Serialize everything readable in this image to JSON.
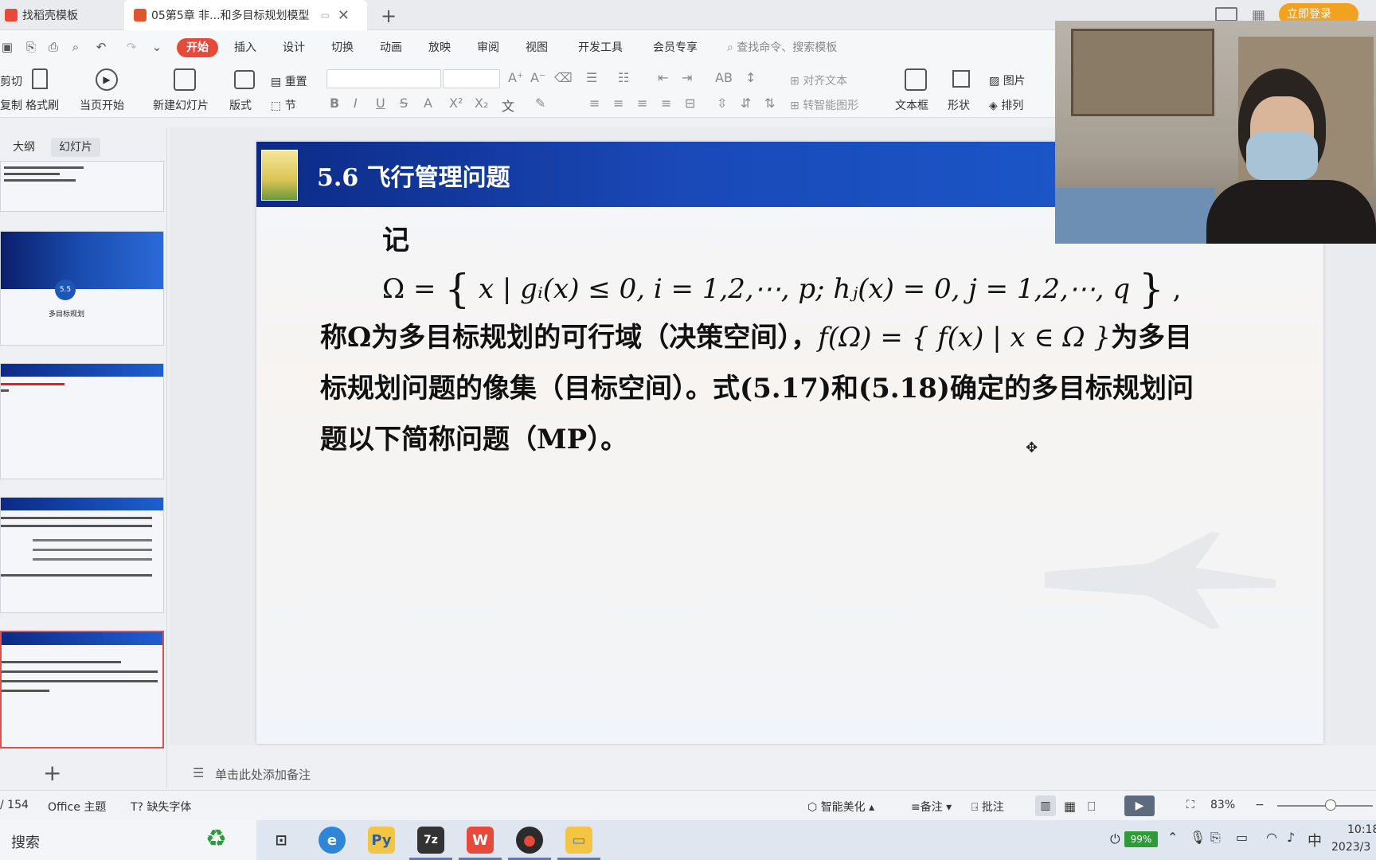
{
  "tabs": [
    {
      "label": "找稻壳模板"
    },
    {
      "label": "05第5章  非...和多目标规划模型"
    }
  ],
  "login_label": "立即登录",
  "menu": {
    "items": [
      "开始",
      "插入",
      "设计",
      "切换",
      "动画",
      "放映",
      "审阅",
      "视图",
      "开发工具",
      "会员专享"
    ],
    "search_placeholder": "查找命令、搜索模板"
  },
  "ribbon": {
    "cut": "剪切",
    "copy": "复制",
    "format_painter": "格式刷",
    "play_from_current": "当页开始",
    "new_slide": "新建幻灯片",
    "layout": "版式",
    "reset": "重置",
    "section": "节",
    "align_text": "对齐文本",
    "smart_shape": "转智能图形",
    "textbox": "文本框",
    "shape": "形状",
    "picture": "图片",
    "arrange": "排列"
  },
  "left_pane": {
    "outline_tab": "大纲",
    "slides_tab": "幻灯片",
    "thumb2_badge": "5.5",
    "thumb2_text": "多目标规划"
  },
  "slide": {
    "title": "5.6 飞行管理问题",
    "line1": "记",
    "omega_lhs": "Ω =",
    "omega_set": "x | gᵢ(x) ≤ 0, i = 1,2,⋯, p; hⱼ(x) = 0, j = 1,2,⋯, q",
    "omega_tail": ",",
    "line3_a": "称Ω为多目标规划的可行域（决策空间），",
    "line3_math": "f(Ω) = { f(x) | x ∈ Ω }",
    "line3_b": "为多目",
    "line4": "标规划问题的像集（目标空间）。式(5.17)和(5.18)确定的多目标规划问",
    "line5": "题以下简称问题（MP）。"
  },
  "notes_placeholder": "单击此处添加备注",
  "status": {
    "page": "/ 154",
    "theme": "Office 主题",
    "missing_font": "缺失字体",
    "beautify": "智能美化",
    "notes": "备注",
    "comments": "批注",
    "zoom": "83%"
  },
  "taskbar": {
    "search": "搜索",
    "battery": "99%",
    "ime": "中",
    "time": "10:18",
    "date": "2023/3"
  }
}
